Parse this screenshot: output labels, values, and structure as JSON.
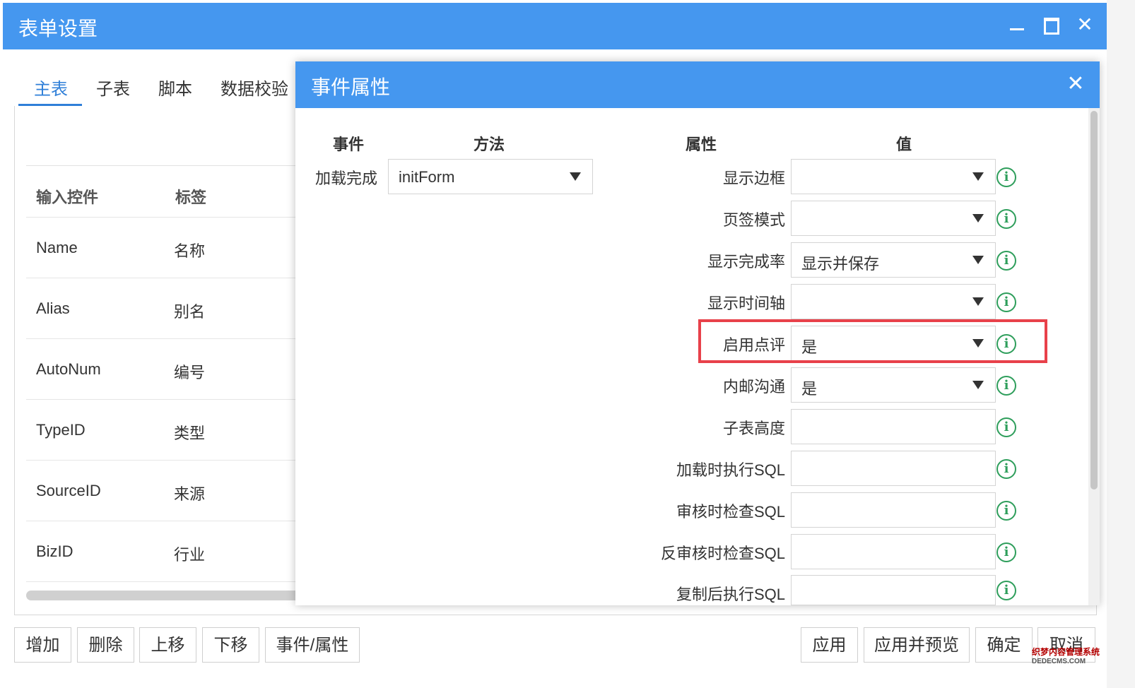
{
  "window": {
    "title": "表单设置",
    "minimize_icon": "minimize-icon",
    "maximize_icon": "maximize-icon",
    "close_icon": "close-icon"
  },
  "tabs": [
    {
      "label": "主表",
      "active": true
    },
    {
      "label": "子表",
      "active": false
    },
    {
      "label": "脚本",
      "active": false
    },
    {
      "label": "数据校验",
      "active": false
    }
  ],
  "grid": {
    "headers": [
      "输入控件",
      "标签"
    ],
    "rows": [
      {
        "control": "Name",
        "label": "名称"
      },
      {
        "control": "Alias",
        "label": "别名"
      },
      {
        "control": "AutoNum",
        "label": "编号"
      },
      {
        "control": "TypeID",
        "label": "类型"
      },
      {
        "control": "SourceID",
        "label": "来源"
      },
      {
        "control": "BizID",
        "label": "行业"
      }
    ]
  },
  "toolbar": {
    "left_buttons": [
      "增加",
      "删除",
      "上移",
      "下移",
      "事件/属性"
    ],
    "right_buttons": [
      "应用",
      "应用并预览",
      "确定",
      "取消"
    ]
  },
  "dialog": {
    "title": "事件属性",
    "headers": {
      "event": "事件",
      "method": "方法",
      "property": "属性",
      "value": "值"
    },
    "event_row": {
      "event": "加载完成",
      "method": "initForm"
    },
    "properties": [
      {
        "label": "显示边框",
        "value": "",
        "dropdown": true
      },
      {
        "label": "页签模式",
        "value": "",
        "dropdown": true
      },
      {
        "label": "显示完成率",
        "value": "显示并保存",
        "dropdown": true
      },
      {
        "label": "显示时间轴",
        "value": "",
        "dropdown": true
      },
      {
        "label": "启用点评",
        "value": "是",
        "dropdown": true,
        "highlighted": true
      },
      {
        "label": "内邮沟通",
        "value": "是",
        "dropdown": true
      },
      {
        "label": "子表高度",
        "value": "",
        "dropdown": false
      },
      {
        "label": "加载时执行SQL",
        "value": "",
        "dropdown": false
      },
      {
        "label": "审核时检查SQL",
        "value": "",
        "dropdown": false
      },
      {
        "label": "反审核时检查SQL",
        "value": "",
        "dropdown": false
      },
      {
        "label": "复制后执行SQL",
        "value": "",
        "dropdown": false
      }
    ],
    "info_icon": "info-icon",
    "highlight_color": "#e8414a"
  },
  "colors": {
    "titlebar": "#4597ef",
    "tab_active": "#2f7fd8",
    "info_icon": "#2e9e5b"
  },
  "watermark": {
    "line1": "织梦内容管理系统",
    "line2": "DEDECMS.COM"
  }
}
